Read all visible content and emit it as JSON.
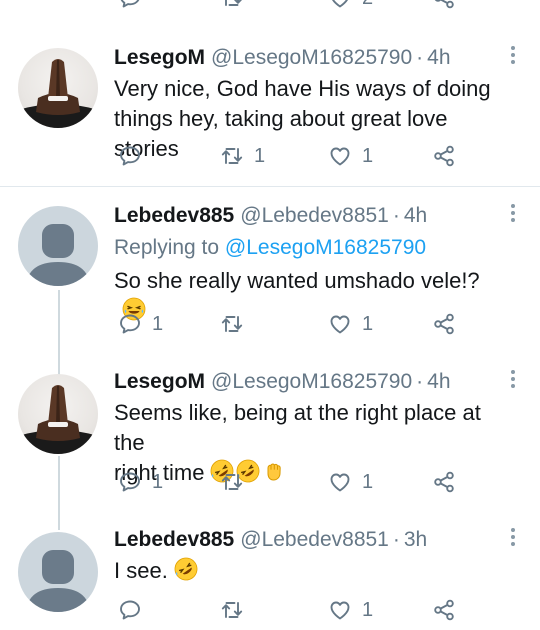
{
  "top_action_bar": {
    "likes": "2"
  },
  "tweets": [
    {
      "name": "LesegoM",
      "handle": "@LesegoM16825790",
      "time": "4h",
      "text_lines": [
        "Very nice, God have His ways of doing",
        "things hey, taking about great love stories"
      ],
      "replies": "",
      "retweets": "1",
      "likes": "1"
    },
    {
      "name": "Lebedev885",
      "handle": "@Lebedev8851",
      "time": "4h",
      "replying_label": "Replying to",
      "replying_to": "@LesegoM16825790",
      "text": "So she really wanted umshado vele!?",
      "replies": "1",
      "retweets": "",
      "likes": "1"
    },
    {
      "name": "LesegoM",
      "handle": "@LesegoM16825790",
      "time": "4h",
      "text_lines": [
        "Seems like, being at the right place at the",
        "right time"
      ],
      "replies": "1",
      "retweets": "",
      "likes": "1"
    },
    {
      "name": "Lebedev885",
      "handle": "@Lebedev8851",
      "time": "3h",
      "text": "I see.",
      "replies": "",
      "retweets": "",
      "likes": "1"
    }
  ],
  "header_separator": "·",
  "icons": [
    "reply-icon",
    "retweet-icon",
    "like-icon",
    "share-icon",
    "more-icon"
  ],
  "colors": {
    "mention": "#1da1f2",
    "secondary": "#657786",
    "thread_line": "#cfd9de"
  }
}
